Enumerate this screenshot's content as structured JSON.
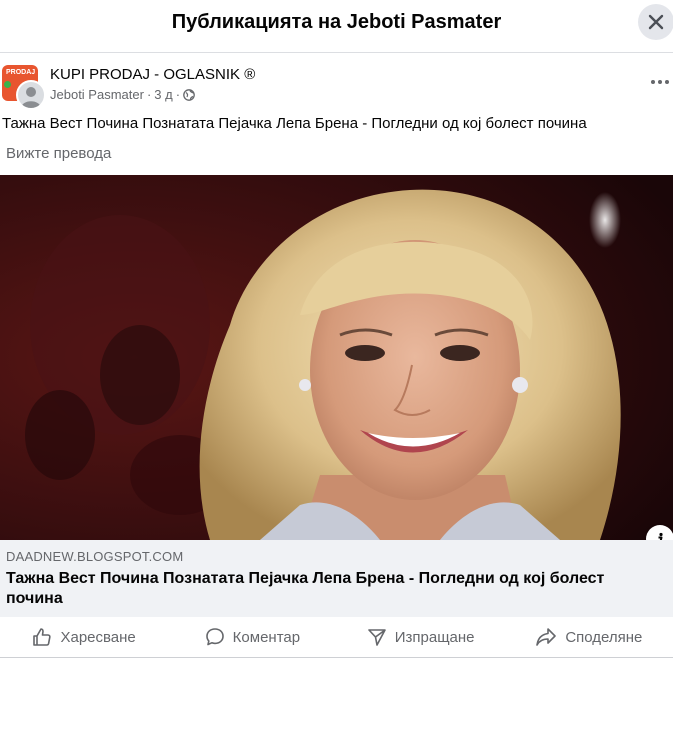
{
  "dialog": {
    "title": "Публикацията на Jeboti Pasmater"
  },
  "post": {
    "page_name": "KUPI PRODAJ - OGLASNIK ®",
    "page_avatar_text": "PRODAJ",
    "author": "Jeboti Pasmater",
    "time": "3 д",
    "separator": "·",
    "text": "Тажна Вест Почина Познатата Пејачка Лепа Брена - Погледни од кој болест почина",
    "see_translation": "Вижте превода"
  },
  "link_card": {
    "domain": "DAADNEW.BLOGSPOT.COM",
    "title": "Тажна Вест Почина Познатата Пејачка Лепа Брена - Погледни од кој болест почина"
  },
  "actions": {
    "like": "Харесване",
    "comment": "Коментар",
    "send": "Изпращане",
    "share": "Споделяне"
  },
  "colors": {
    "secondary_text": "#65676b",
    "card_bg": "#f0f2f5",
    "close_bg": "#e4e6eb"
  }
}
